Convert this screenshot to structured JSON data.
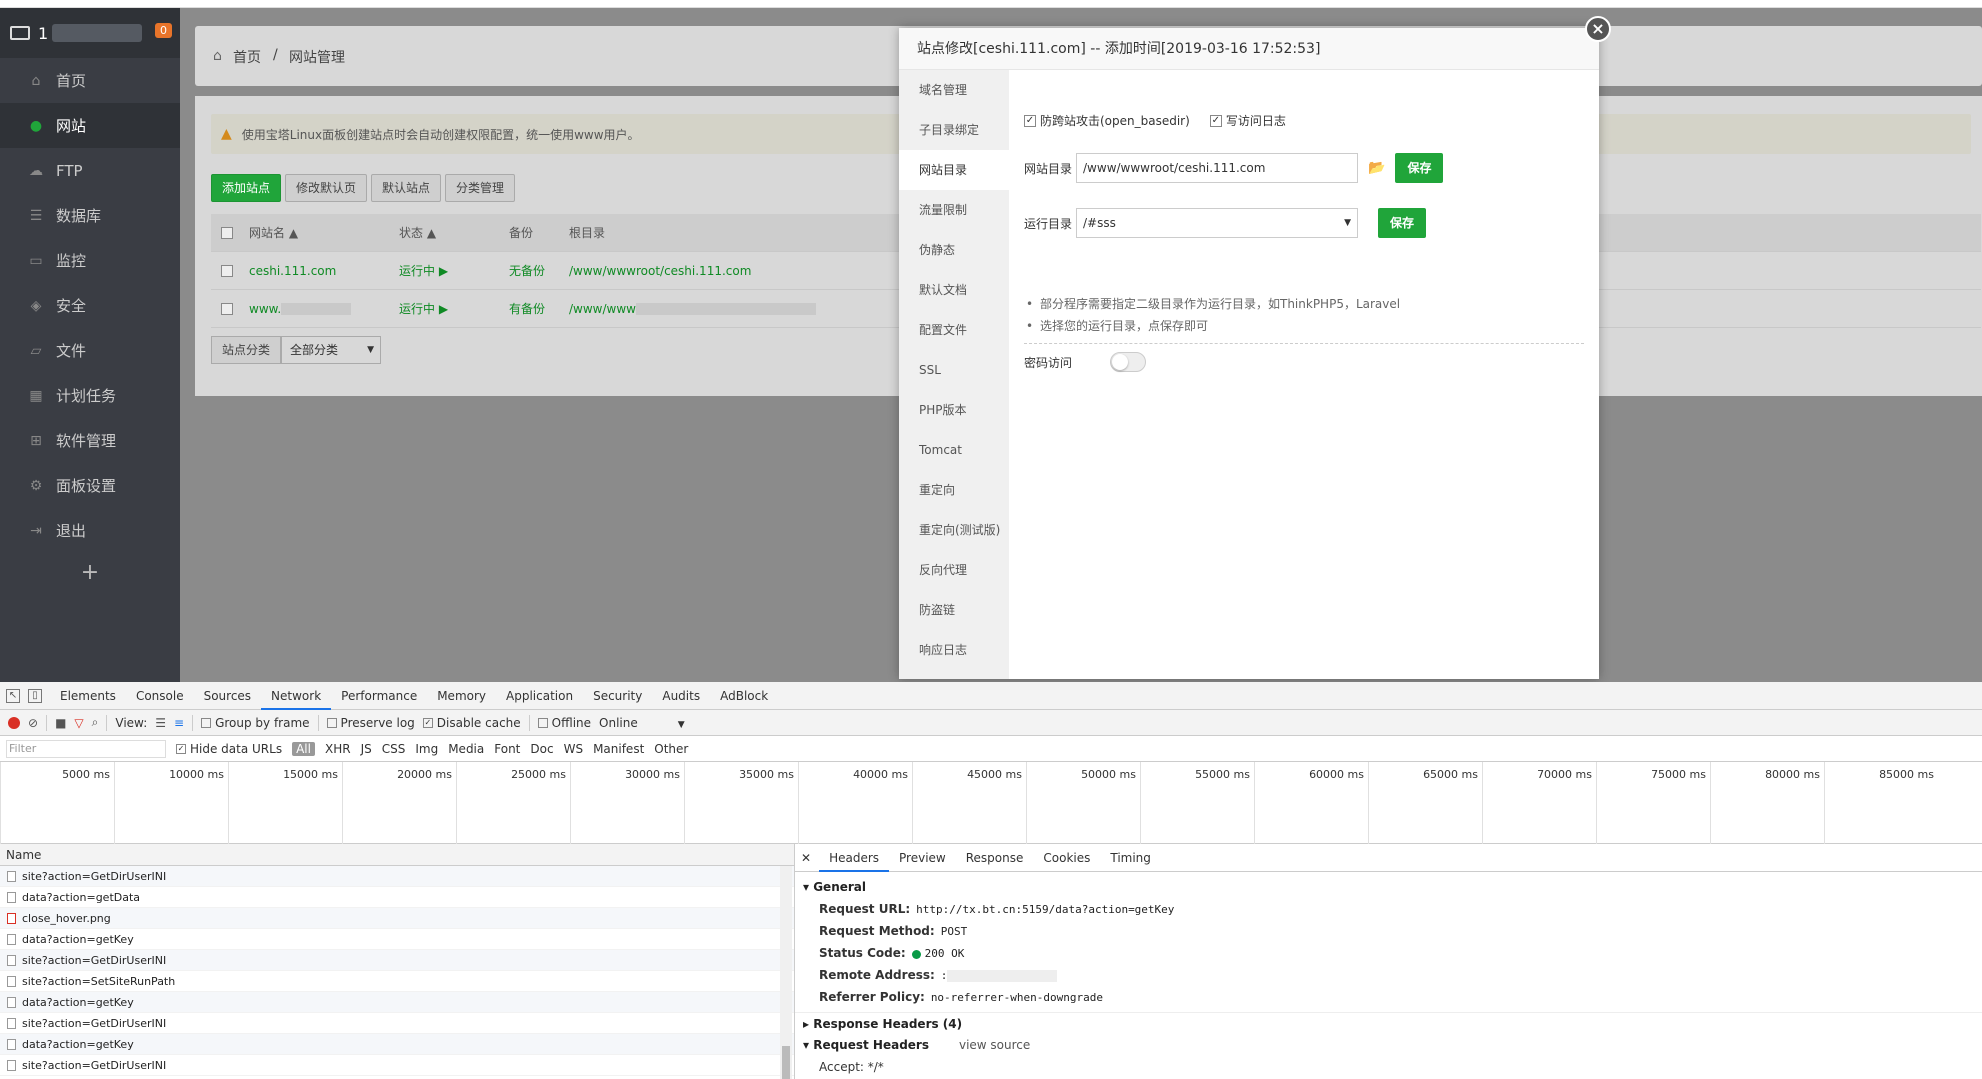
{
  "sidebar": {
    "title": "1",
    "badge": "0",
    "items": [
      {
        "label": "首页",
        "icon": "home-icon"
      },
      {
        "label": "网站",
        "icon": "globe-icon"
      },
      {
        "label": "FTP",
        "icon": "ftp-icon"
      },
      {
        "label": "数据库",
        "icon": "database-icon"
      },
      {
        "label": "监控",
        "icon": "monitor-icon"
      },
      {
        "label": "安全",
        "icon": "shield-icon"
      },
      {
        "label": "文件",
        "icon": "folder-icon"
      },
      {
        "label": "计划任务",
        "icon": "calendar-icon"
      },
      {
        "label": "软件管理",
        "icon": "grid-icon"
      },
      {
        "label": "面板设置",
        "icon": "gear-icon"
      },
      {
        "label": "退出",
        "icon": "logout-icon"
      }
    ],
    "add": "+"
  },
  "breadcrumb": {
    "home": "首页",
    "sep": "/",
    "current": "网站管理"
  },
  "alert": "使用宝塔Linux面板创建站点时会自动创建权限配置，统一使用www用户。",
  "buttons": [
    "添加站点",
    "修改默认页",
    "默认站点",
    "分类管理"
  ],
  "table": {
    "headers": {
      "name": "网站名 ▲",
      "status": "状态 ▲",
      "backup": "备份",
      "root": "根目录"
    },
    "rows": [
      {
        "name": "ceshi.111.com",
        "status": "运行中 ▶",
        "backup": "无备份",
        "root": "/www/wwwroot/ceshi.111.com"
      },
      {
        "name": "www.",
        "status": "运行中 ▶",
        "backup": "有备份",
        "root": "/www/www"
      }
    ]
  },
  "filter": {
    "label": "站点分类",
    "value": "全部分类"
  },
  "modal": {
    "title": "站点修改[ceshi.111.com] -- 添加时间[2019-03-16 17:52:53]",
    "close": "×",
    "nav": [
      "域名管理",
      "子目录绑定",
      "网站目录",
      "流量限制",
      "伪静态",
      "默认文档",
      "配置文件",
      "SSL",
      "PHP版本",
      "Tomcat",
      "重定向",
      "重定向(测试版)",
      "反向代理",
      "防盗链",
      "响应日志"
    ],
    "check1": "防跨站攻击(open_basedir)",
    "check2": "写访问日志",
    "site_dir_label": "网站目录",
    "site_dir_value": "/www/wwwroot/ceshi.111.com",
    "save": "保存",
    "run_dir_label": "运行目录",
    "run_dir_value": "/#sss",
    "tips": [
      "部分程序需要指定二级目录作为运行目录，如ThinkPHP5，Laravel",
      "选择您的运行目录，点保存即可"
    ],
    "password_label": "密码访问"
  },
  "devtools": {
    "tabs": [
      "Elements",
      "Console",
      "Sources",
      "Network",
      "Performance",
      "Memory",
      "Application",
      "Security",
      "Audits",
      "AdBlock"
    ],
    "toolbar": {
      "view": "View:",
      "group": "Group by frame",
      "preserve": "Preserve log",
      "disable": "Disable cache",
      "offline": "Offline",
      "online": "Online"
    },
    "filter": {
      "placeholder": "Filter",
      "hide": "Hide data URLs",
      "types": [
        "All",
        "XHR",
        "JS",
        "CSS",
        "Img",
        "Media",
        "Font",
        "Doc",
        "WS",
        "Manifest",
        "Other"
      ]
    },
    "ticks": [
      "5000 ms",
      "10000 ms",
      "15000 ms",
      "20000 ms",
      "25000 ms",
      "30000 ms",
      "35000 ms",
      "40000 ms",
      "45000 ms",
      "50000 ms",
      "55000 ms",
      "60000 ms",
      "65000 ms",
      "70000 ms",
      "75000 ms",
      "80000 ms",
      "85000 ms"
    ],
    "name_header": "Name",
    "requests": [
      "site?action=GetDirUserINI",
      "data?action=getData",
      "close_hover.png",
      "data?action=getKey",
      "site?action=GetDirUserINI",
      "site?action=SetSiteRunPath",
      "data?action=getKey",
      "site?action=GetDirUserINI",
      "data?action=getKey",
      "site?action=GetDirUserINI"
    ],
    "detail_tabs": [
      "Headers",
      "Preview",
      "Response",
      "Cookies",
      "Timing"
    ],
    "general": "General",
    "kv": [
      {
        "k": "Request URL:",
        "v": "http://tx.bt.cn:5159/data?action=getKey"
      },
      {
        "k": "Request Method:",
        "v": "POST"
      },
      {
        "k": "Status Code:",
        "v": "200 OK"
      },
      {
        "k": "Remote Address:",
        "v": ":"
      },
      {
        "k": "Referrer Policy:",
        "v": "no-referrer-when-downgrade"
      }
    ],
    "response_headers": "Response Headers (4)",
    "request_headers": "Request Headers",
    "view_source": "view source",
    "accept": "Accept: */*"
  }
}
